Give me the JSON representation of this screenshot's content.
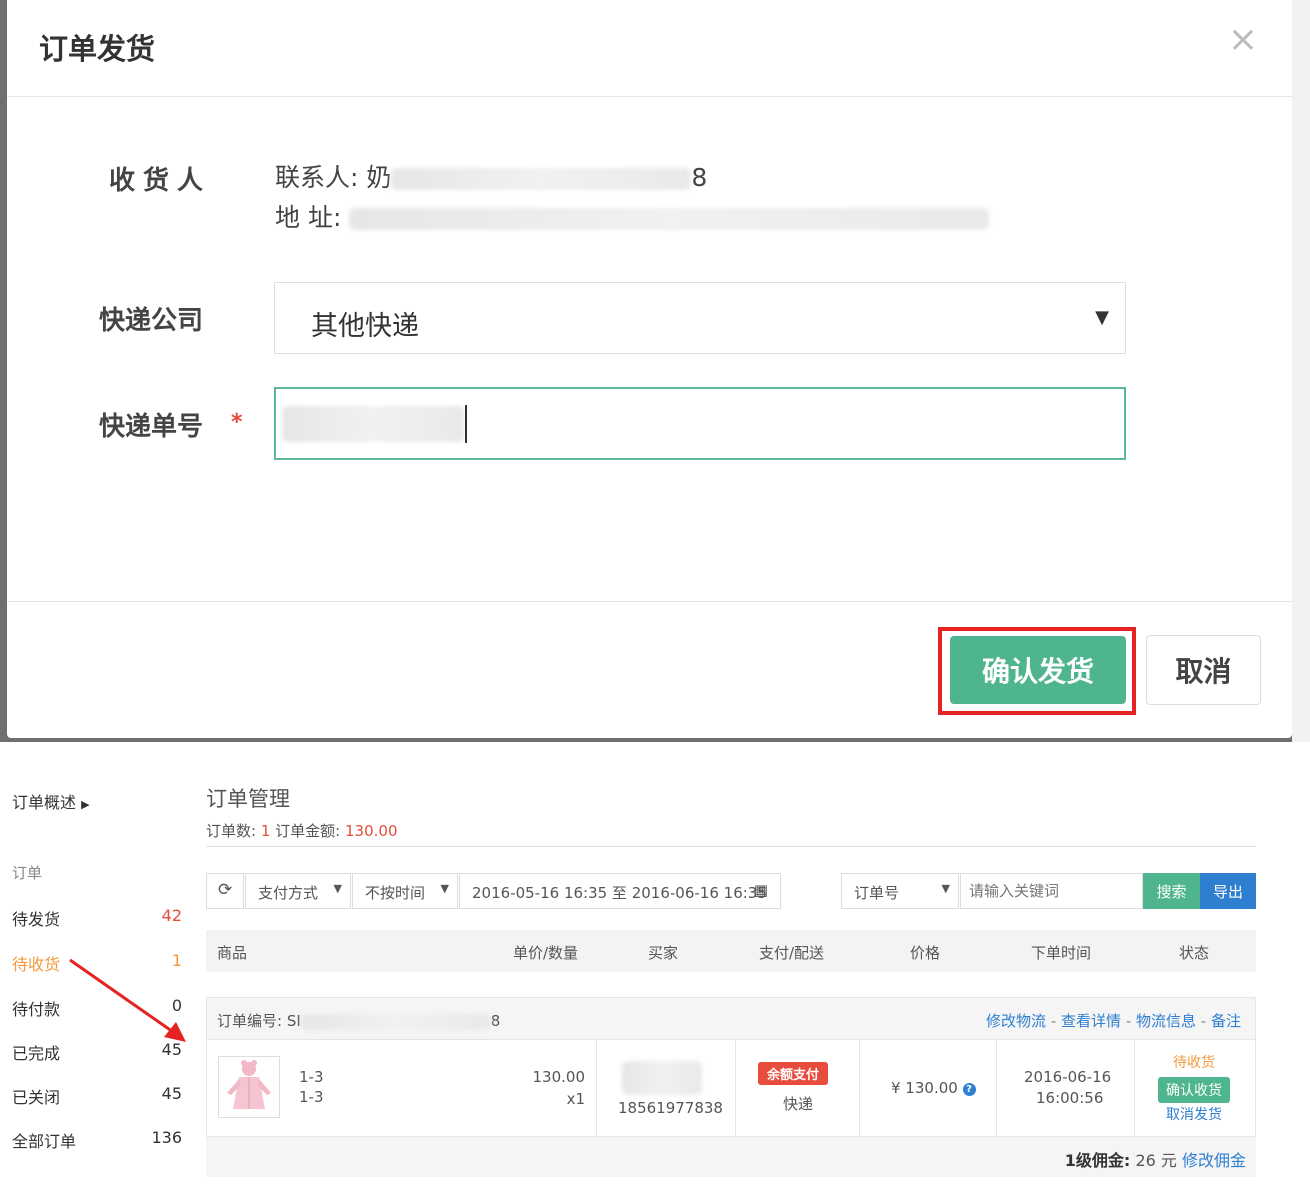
{
  "modal": {
    "title": "订单发货",
    "close_icon": "×",
    "receiver_label": "收货人",
    "contact_prefix": "联系人: 奶",
    "contact_suffix": "8",
    "address_prefix": "地 址:",
    "express_label": "快递公司",
    "express_selected": "其他快递",
    "tracking_label": "快递单号",
    "required_mark": "*",
    "confirm_button": "确认发货",
    "cancel_button": "取消"
  },
  "sidebar": {
    "overview": "订单概述",
    "section": "订单",
    "items": [
      {
        "label": "待发货",
        "count": "42"
      },
      {
        "label": "待收货",
        "count": "1"
      },
      {
        "label": "待付款",
        "count": "0"
      },
      {
        "label": "已完成",
        "count": "45"
      },
      {
        "label": "已关闭",
        "count": "45"
      },
      {
        "label": "全部订单",
        "count": "136"
      }
    ]
  },
  "main": {
    "title": "订单管理",
    "summary_count_label": "订单数:",
    "summary_count": "1",
    "summary_amount_label": "订单金额:",
    "summary_amount": "130.00",
    "toolbar": {
      "refresh_icon": "⟳",
      "payment_filter": "支付方式",
      "time_filter": "不按时间",
      "date_range": "2016-05-16 16:35 至 2016-06-16 16:35",
      "calendar_icon": "▦",
      "search_field": "订单号",
      "search_placeholder": "请输入关键词",
      "search_button": "搜索",
      "export_button": "导出"
    },
    "table_headers": [
      "商品",
      "单价/数量",
      "买家",
      "支付/配送",
      "价格",
      "下单时间",
      "状态"
    ],
    "order": {
      "order_no_label": "订单编号: SI",
      "order_no_suffix": "8",
      "actions": [
        "修改物流",
        "查看详情",
        "物流信息",
        "备注"
      ],
      "sku1": "1-3",
      "sku2": "1-3",
      "unit_price": "130.00",
      "quantity": "x1",
      "buyer_phone": "18561977838",
      "payment_badge": "余额支付",
      "delivery": "快递",
      "price": "¥ 130.00",
      "date": "2016-06-16",
      "time": "16:00:56",
      "status": "待收货",
      "confirm_receipt": "确认收货",
      "cancel_shipment": "取消发货"
    },
    "commission_label": "1级佣金:",
    "commission_value": "26 元",
    "commission_edit": "修改佣金"
  },
  "colors": {
    "accent_green": "#4eb58e",
    "accent_blue": "#2f7fd1",
    "highlight_red": "#e52323",
    "status_orange": "#f39a3d"
  }
}
